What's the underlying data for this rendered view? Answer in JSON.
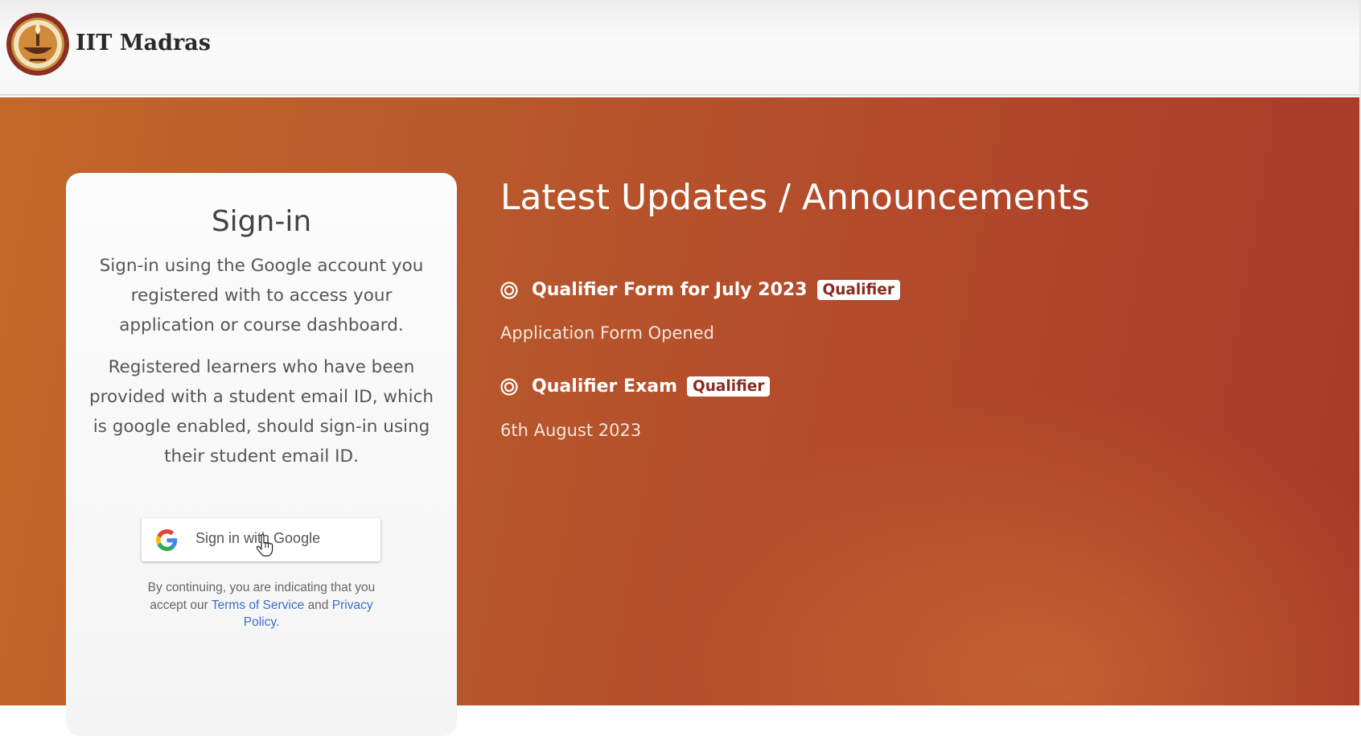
{
  "header": {
    "brand": "IIT Madras",
    "logo_icon": "iit-madras-emblem-icon"
  },
  "signin": {
    "title": "Sign-in",
    "description_1": "Sign-in using the Google account you registered with to access your application or course dashboard.",
    "description_2": "Registered learners who have been provided with a student email ID, which is google enabled, should sign-in using their student email ID.",
    "google_button_label": "Sign in with Google",
    "legal_prefix": "By continuing, you are indicating that you accept our",
    "terms_link": "Terms of Service",
    "legal_and": "and",
    "privacy_link": "Privacy Policy",
    "legal_suffix": "."
  },
  "updates": {
    "title": "Latest Updates / Announcements",
    "items": [
      {
        "title": "Qualifier Form for July 2023",
        "badge": "Qualifier",
        "subtitle": "Application Form Opened"
      },
      {
        "title": "Qualifier Exam",
        "badge": "Qualifier",
        "subtitle": "6th August 2023"
      }
    ]
  },
  "colors": {
    "accent": "#b34b2b",
    "badge_text": "#8a2a1e",
    "link": "#3b6fc9"
  }
}
